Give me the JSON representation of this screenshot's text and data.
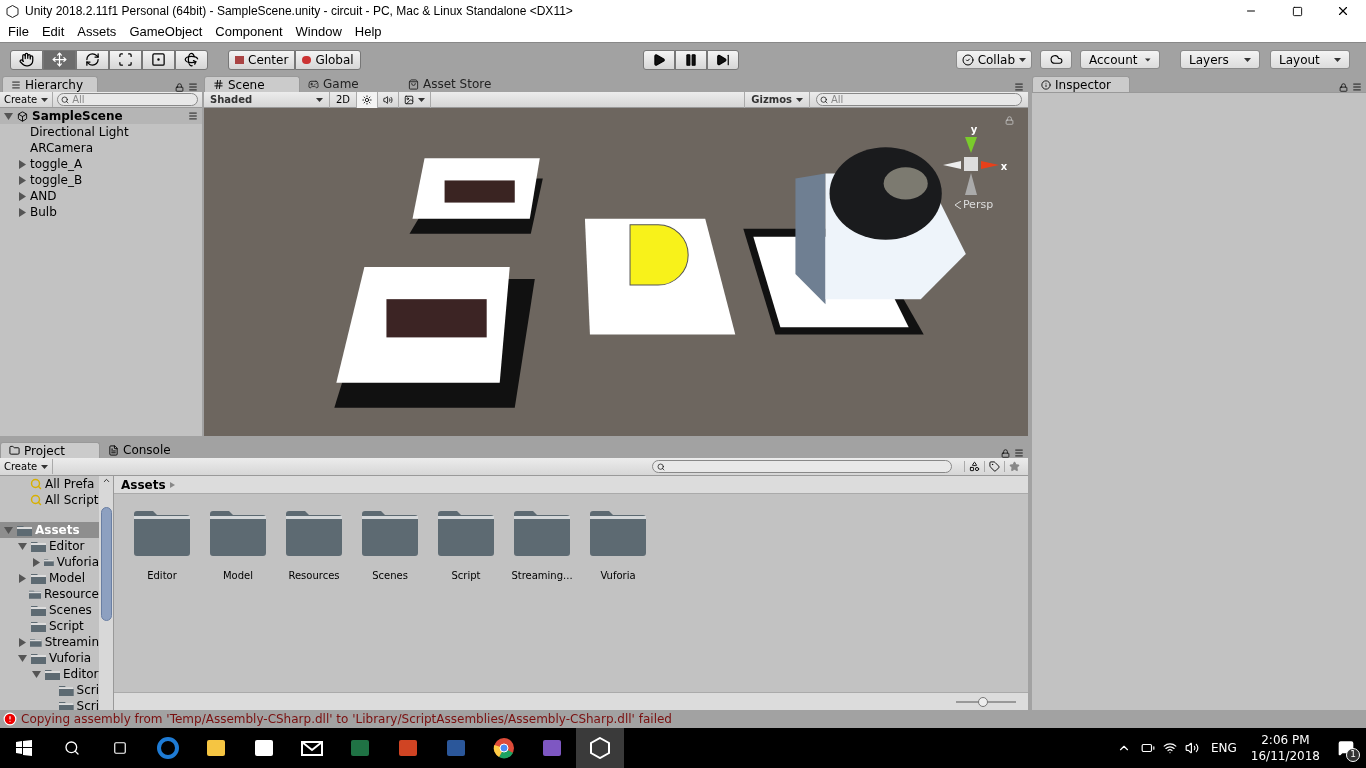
{
  "window": {
    "title": "Unity 2018.2.11f1 Personal (64bit) - SampleScene.unity - circuit - PC, Mac & Linux Standalone <DX11>"
  },
  "menu": [
    "File",
    "Edit",
    "Assets",
    "GameObject",
    "Component",
    "Window",
    "Help"
  ],
  "toolbar": {
    "tools": [
      {
        "kind": "hand",
        "selected": false
      },
      {
        "kind": "move",
        "selected": true
      },
      {
        "kind": "rotate",
        "selected": false
      },
      {
        "kind": "scale",
        "selected": false
      },
      {
        "kind": "rect",
        "selected": false
      },
      {
        "kind": "transform",
        "selected": false
      }
    ],
    "pivot": [
      "Center",
      "Global"
    ],
    "play": [
      {
        "kind": "play"
      },
      {
        "kind": "pause"
      },
      {
        "kind": "step"
      }
    ],
    "collab": "Collab",
    "account": "Account",
    "layers": "Layers",
    "layout": "Layout"
  },
  "hierarchy": {
    "tab": "Hierarchy",
    "create": "Create",
    "search": {
      "placeholder": "All"
    },
    "scene": "SampleScene",
    "items": [
      {
        "label": "Directional Light",
        "kind": "leaf"
      },
      {
        "label": "ARCamera",
        "kind": "leaf"
      },
      {
        "label": "toggle_A",
        "kind": "group"
      },
      {
        "label": "toggle_B",
        "kind": "group"
      },
      {
        "label": "AND",
        "kind": "group"
      },
      {
        "label": "Bulb",
        "kind": "group"
      }
    ]
  },
  "scene_tabs": [
    {
      "label": "Scene",
      "kind": "scene",
      "selected": true
    },
    {
      "label": "Game",
      "kind": "game",
      "selected": false
    },
    {
      "label": "Asset Store",
      "kind": "store",
      "selected": false
    }
  ],
  "scene_toolbar": {
    "shading": "Shaded",
    "mode_2d": "2D",
    "gizmos": "Gizmos",
    "search": {
      "placeholder": "All"
    }
  },
  "gizmo": {
    "y": "y",
    "x": "x",
    "projection": "Persp"
  },
  "inspector": {
    "tab": "Inspector"
  },
  "project_tabs": [
    {
      "label": "Project",
      "kind": "project",
      "selected": true
    },
    {
      "label": "Console",
      "kind": "console",
      "selected": false
    }
  ],
  "project": {
    "create": "Create",
    "favorites": [
      "All Prefa",
      "All Script"
    ],
    "tree": [
      {
        "label": "Assets",
        "selected": true,
        "expanded": true,
        "children": [
          {
            "label": "Editor",
            "selected": false,
            "expanded": true,
            "children": [
              {
                "label": "Vuforia",
                "selected": false,
                "expanded": false
              }
            ]
          },
          {
            "label": "Model",
            "selected": false,
            "expanded": false
          },
          {
            "label": "Resource",
            "selected": false
          },
          {
            "label": "Scenes",
            "selected": false
          },
          {
            "label": "Script",
            "selected": false
          },
          {
            "label": "Streamin",
            "selected": false,
            "expanded": false
          },
          {
            "label": "Vuforia",
            "selected": false,
            "expanded": true,
            "children": [
              {
                "label": "Editor",
                "selected": false,
                "expanded": true,
                "children": [
                  {
                    "label": "Scri",
                    "selected": false
                  },
                  {
                    "label": "Scri",
                    "selected": false
                  }
                ]
              }
            ]
          }
        ]
      }
    ],
    "breadcrumb": "Assets",
    "folders": [
      "Editor",
      "Model",
      "Resources",
      "Scenes",
      "Script",
      "Streaming...",
      "Vuforia"
    ],
    "zoom": {
      "level": 0.45
    }
  },
  "status": {
    "message": "Copying assembly from 'Temp/Assembly-CSharp.dll' to 'Library/ScriptAssemblies/Assembly-CSharp.dll' failed"
  },
  "taskbar": {
    "apps": [
      {
        "kind": "edge",
        "selected": false
      },
      {
        "kind": "explorer",
        "selected": false
      },
      {
        "kind": "store",
        "selected": false
      },
      {
        "kind": "mail",
        "selected": false
      },
      {
        "kind": "excel",
        "selected": false
      },
      {
        "kind": "powerpoint",
        "selected": false
      },
      {
        "kind": "word",
        "selected": false
      },
      {
        "kind": "chrome",
        "selected": false
      },
      {
        "kind": "visualstudio",
        "selected": false
      },
      {
        "kind": "unity",
        "selected": true
      }
    ],
    "language": "ENG",
    "time": "2:06 PM",
    "date": "16/11/2018",
    "notifications": "1"
  }
}
